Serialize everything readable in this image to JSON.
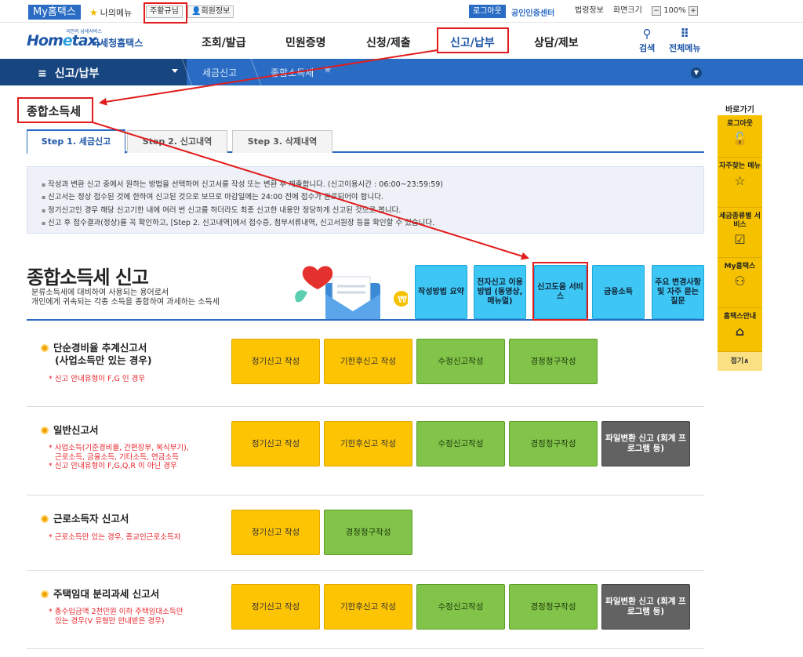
{
  "topbar": {
    "my_hometax": "My홈택스",
    "my_menu": "나의메뉴",
    "preferences": "주활규님",
    "member_info": "회원정보",
    "logout": "로그아웃",
    "cert_center": "공인인증센터",
    "law_info": "법령정보",
    "screen_size": "화면크기",
    "zoom_minus": "−",
    "zoom": "100%",
    "zoom_plus": "+"
  },
  "header": {
    "logo_tiny": "국민의 납세서비스",
    "logo_main_a": "Hom",
    "logo_main_e": "e",
    "logo_main_b": "tax.",
    "logo_sub": "국세청홈택스",
    "gnb": [
      "조회/발급",
      "민원증명",
      "신청/제출",
      "신고/납부",
      "상담/제보"
    ],
    "search": "검색",
    "all_menu": "전체메뉴"
  },
  "nav": {
    "current": "신고/납부",
    "crumb1": "세금신고",
    "crumb2": "종합소득세"
  },
  "quick": {
    "title": "바로가기",
    "items": [
      "로그아웃",
      "자주찾는 메뉴",
      "세금종류별 서비스",
      "My홈택스",
      "홈택스안내"
    ],
    "close": "접기∧"
  },
  "page": {
    "title": "종합소득세",
    "tabs": [
      "Step 1. 세금신고",
      "Step 2. 신고내역",
      "Step 3. 삭제내역"
    ],
    "info": [
      "작성과 변환 신고 중에서 원하는 방법을 선택하여 신고서를 작성 또는 변환 후 제출합니다. (신고이용시간 : 06:00~23:59:59)",
      "신고서는 정상 접수된 것에 한하여 신고된 것으로 보므로 마감일에는 24:00 전에 접수가 완료되어야 합니다.",
      "정기신고인 경우 해당 신고기한 내에 여러 번 신고를 하더라도 최종 신고한 내용만 정당하게 신고된 것으로 봅니다.",
      "신고 후 접수결과(정상)를 꼭 확인하고, [Step 2. 신고내역]에서 접수증, 첨부서류내역, 신고서원장 등을 확인할 수 있습니다."
    ],
    "section_title": "종합소득세 신고",
    "section_desc1": "분류소득세에 대비하여 사용되는 용어로서",
    "section_desc2": "개인에게 귀속되는 각종 소득을 종합하여 과세하는 소득세",
    "tiles": [
      "작성방법 요약",
      "전자신고 이용방법 (동영상, 매뉴얼)",
      "신고도움 서비스",
      "금융소득",
      "주요 변경사항 및 자주 묻는 질문"
    ]
  },
  "rows": [
    {
      "title1": "단순경비율 추계신고서",
      "title2": "(사업소득만 있는 경우)",
      "notes": [
        "* 신고 안내유형이 F,G 인 경우"
      ],
      "buttons": [
        "정기신고 작성",
        "기한후신고 작성",
        "수정신고작성",
        "경정청구작성"
      ]
    },
    {
      "title1": "일반신고서",
      "title2": "",
      "notes": [
        "* 사업소득(기준경비율, 간편장부, 복식부기),",
        "근로소득, 금융소득, 기타소득, 연금소득",
        "* 신고 안내유형이 F,G,Q,R 이 아닌 경우"
      ],
      "buttons": [
        "정기신고 작성",
        "기한후신고 작성",
        "수정신고작성",
        "경정청구작성",
        "파일변환 신고 (회계 프로그램 등)"
      ]
    },
    {
      "title1": "근로소득자 신고서",
      "title2": "",
      "notes": [
        "* 근로소득만 있는 경우, 종교인근로소득자"
      ],
      "buttons": [
        "정기신고 작성",
        "경정청구작성"
      ]
    },
    {
      "title1": "주택임대 분리과세 신고서",
      "title2": "",
      "notes": [
        "* 총수입금액 2천만원 이하 주택임대소득만",
        "있는 경우(V 유형만 안내받은 경우)"
      ],
      "buttons": [
        "정기신고 작성",
        "기한후신고 작성",
        "수정신고작성",
        "경정청구작성",
        "파일변환 신고 (회계 프로그램 등)"
      ]
    }
  ]
}
